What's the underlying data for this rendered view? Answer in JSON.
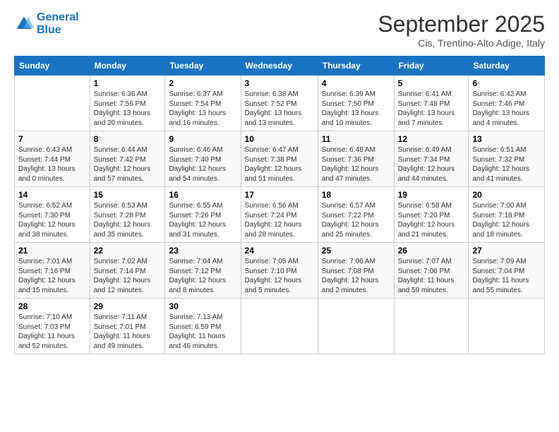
{
  "header": {
    "logo_line1": "General",
    "logo_line2": "Blue",
    "month_title": "September 2025",
    "subtitle": "Cis, Trentino-Alto Adige, Italy"
  },
  "days_of_week": [
    "Sunday",
    "Monday",
    "Tuesday",
    "Wednesday",
    "Thursday",
    "Friday",
    "Saturday"
  ],
  "weeks": [
    [
      {
        "num": "",
        "sunrise": "",
        "sunset": "",
        "daylight": ""
      },
      {
        "num": "1",
        "sunrise": "Sunrise: 6:36 AM",
        "sunset": "Sunset: 7:56 PM",
        "daylight": "Daylight: 13 hours and 20 minutes."
      },
      {
        "num": "2",
        "sunrise": "Sunrise: 6:37 AM",
        "sunset": "Sunset: 7:54 PM",
        "daylight": "Daylight: 13 hours and 16 minutes."
      },
      {
        "num": "3",
        "sunrise": "Sunrise: 6:38 AM",
        "sunset": "Sunset: 7:52 PM",
        "daylight": "Daylight: 13 hours and 13 minutes."
      },
      {
        "num": "4",
        "sunrise": "Sunrise: 6:39 AM",
        "sunset": "Sunset: 7:50 PM",
        "daylight": "Daylight: 13 hours and 10 minutes."
      },
      {
        "num": "5",
        "sunrise": "Sunrise: 6:41 AM",
        "sunset": "Sunset: 7:48 PM",
        "daylight": "Daylight: 13 hours and 7 minutes."
      },
      {
        "num": "6",
        "sunrise": "Sunrise: 6:42 AM",
        "sunset": "Sunset: 7:46 PM",
        "daylight": "Daylight: 13 hours and 4 minutes."
      }
    ],
    [
      {
        "num": "7",
        "sunrise": "Sunrise: 6:43 AM",
        "sunset": "Sunset: 7:44 PM",
        "daylight": "Daylight: 13 hours and 0 minutes."
      },
      {
        "num": "8",
        "sunrise": "Sunrise: 6:44 AM",
        "sunset": "Sunset: 7:42 PM",
        "daylight": "Daylight: 12 hours and 57 minutes."
      },
      {
        "num": "9",
        "sunrise": "Sunrise: 6:46 AM",
        "sunset": "Sunset: 7:40 PM",
        "daylight": "Daylight: 12 hours and 54 minutes."
      },
      {
        "num": "10",
        "sunrise": "Sunrise: 6:47 AM",
        "sunset": "Sunset: 7:38 PM",
        "daylight": "Daylight: 12 hours and 51 minutes."
      },
      {
        "num": "11",
        "sunrise": "Sunrise: 6:48 AM",
        "sunset": "Sunset: 7:36 PM",
        "daylight": "Daylight: 12 hours and 47 minutes."
      },
      {
        "num": "12",
        "sunrise": "Sunrise: 6:49 AM",
        "sunset": "Sunset: 7:34 PM",
        "daylight": "Daylight: 12 hours and 44 minutes."
      },
      {
        "num": "13",
        "sunrise": "Sunrise: 6:51 AM",
        "sunset": "Sunset: 7:32 PM",
        "daylight": "Daylight: 12 hours and 41 minutes."
      }
    ],
    [
      {
        "num": "14",
        "sunrise": "Sunrise: 6:52 AM",
        "sunset": "Sunset: 7:30 PM",
        "daylight": "Daylight: 12 hours and 38 minutes."
      },
      {
        "num": "15",
        "sunrise": "Sunrise: 6:53 AM",
        "sunset": "Sunset: 7:28 PM",
        "daylight": "Daylight: 12 hours and 35 minutes."
      },
      {
        "num": "16",
        "sunrise": "Sunrise: 6:55 AM",
        "sunset": "Sunset: 7:26 PM",
        "daylight": "Daylight: 12 hours and 31 minutes."
      },
      {
        "num": "17",
        "sunrise": "Sunrise: 6:56 AM",
        "sunset": "Sunset: 7:24 PM",
        "daylight": "Daylight: 12 hours and 28 minutes."
      },
      {
        "num": "18",
        "sunrise": "Sunrise: 6:57 AM",
        "sunset": "Sunset: 7:22 PM",
        "daylight": "Daylight: 12 hours and 25 minutes."
      },
      {
        "num": "19",
        "sunrise": "Sunrise: 6:58 AM",
        "sunset": "Sunset: 7:20 PM",
        "daylight": "Daylight: 12 hours and 21 minutes."
      },
      {
        "num": "20",
        "sunrise": "Sunrise: 7:00 AM",
        "sunset": "Sunset: 7:18 PM",
        "daylight": "Daylight: 12 hours and 18 minutes."
      }
    ],
    [
      {
        "num": "21",
        "sunrise": "Sunrise: 7:01 AM",
        "sunset": "Sunset: 7:16 PM",
        "daylight": "Daylight: 12 hours and 15 minutes."
      },
      {
        "num": "22",
        "sunrise": "Sunrise: 7:02 AM",
        "sunset": "Sunset: 7:14 PM",
        "daylight": "Daylight: 12 hours and 12 minutes."
      },
      {
        "num": "23",
        "sunrise": "Sunrise: 7:04 AM",
        "sunset": "Sunset: 7:12 PM",
        "daylight": "Daylight: 12 hours and 8 minutes."
      },
      {
        "num": "24",
        "sunrise": "Sunrise: 7:05 AM",
        "sunset": "Sunset: 7:10 PM",
        "daylight": "Daylight: 12 hours and 5 minutes."
      },
      {
        "num": "25",
        "sunrise": "Sunrise: 7:06 AM",
        "sunset": "Sunset: 7:08 PM",
        "daylight": "Daylight: 12 hours and 2 minutes."
      },
      {
        "num": "26",
        "sunrise": "Sunrise: 7:07 AM",
        "sunset": "Sunset: 7:06 PM",
        "daylight": "Daylight: 11 hours and 59 minutes."
      },
      {
        "num": "27",
        "sunrise": "Sunrise: 7:09 AM",
        "sunset": "Sunset: 7:04 PM",
        "daylight": "Daylight: 11 hours and 55 minutes."
      }
    ],
    [
      {
        "num": "28",
        "sunrise": "Sunrise: 7:10 AM",
        "sunset": "Sunset: 7:03 PM",
        "daylight": "Daylight: 11 hours and 52 minutes."
      },
      {
        "num": "29",
        "sunrise": "Sunrise: 7:11 AM",
        "sunset": "Sunset: 7:01 PM",
        "daylight": "Daylight: 11 hours and 49 minutes."
      },
      {
        "num": "30",
        "sunrise": "Sunrise: 7:13 AM",
        "sunset": "Sunset: 6:59 PM",
        "daylight": "Daylight: 11 hours and 46 minutes."
      },
      {
        "num": "",
        "sunrise": "",
        "sunset": "",
        "daylight": ""
      },
      {
        "num": "",
        "sunrise": "",
        "sunset": "",
        "daylight": ""
      },
      {
        "num": "",
        "sunrise": "",
        "sunset": "",
        "daylight": ""
      },
      {
        "num": "",
        "sunrise": "",
        "sunset": "",
        "daylight": ""
      }
    ]
  ]
}
